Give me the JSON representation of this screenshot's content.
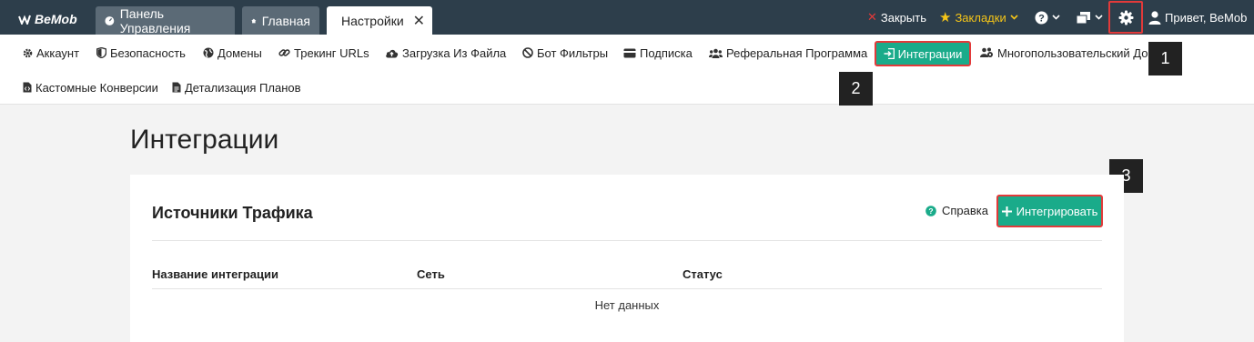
{
  "topbar": {
    "logo": "BeMob",
    "tabs": [
      {
        "label": "Панель Управления"
      },
      {
        "label": "Главная"
      },
      {
        "label": "Настройки"
      }
    ],
    "close_label": "Закрыть",
    "bookmarks_label": "Закладки",
    "greeting": "Привет, BeMob"
  },
  "subnav": {
    "items": [
      {
        "label": "Аккаунт"
      },
      {
        "label": "Безопасность"
      },
      {
        "label": "Домены"
      },
      {
        "label": "Трекинг URLs"
      },
      {
        "label": "Загрузка Из Файла"
      },
      {
        "label": "Бот Фильтры"
      },
      {
        "label": "Подписка"
      },
      {
        "label": "Реферальная Программа"
      },
      {
        "label": "Интеграции"
      },
      {
        "label": "Многопользовательский Доступ"
      },
      {
        "label": "Кастомные Конверсии"
      },
      {
        "label": "Детализация Планов"
      }
    ]
  },
  "badges": [
    "1",
    "2",
    "3"
  ],
  "page": {
    "title": "Интеграции"
  },
  "card": {
    "title": "Источники Трафика",
    "help_label": "Справка",
    "integrate_label": "Интегрировать",
    "columns": [
      "Название интеграции",
      "Сеть",
      "Статус"
    ],
    "empty_text": "Нет данных"
  },
  "colors": {
    "topbar": "#2d3e4b",
    "accent": "#1aab8a",
    "highlight": "#e23a3a",
    "bookmarks": "#f5c518"
  }
}
